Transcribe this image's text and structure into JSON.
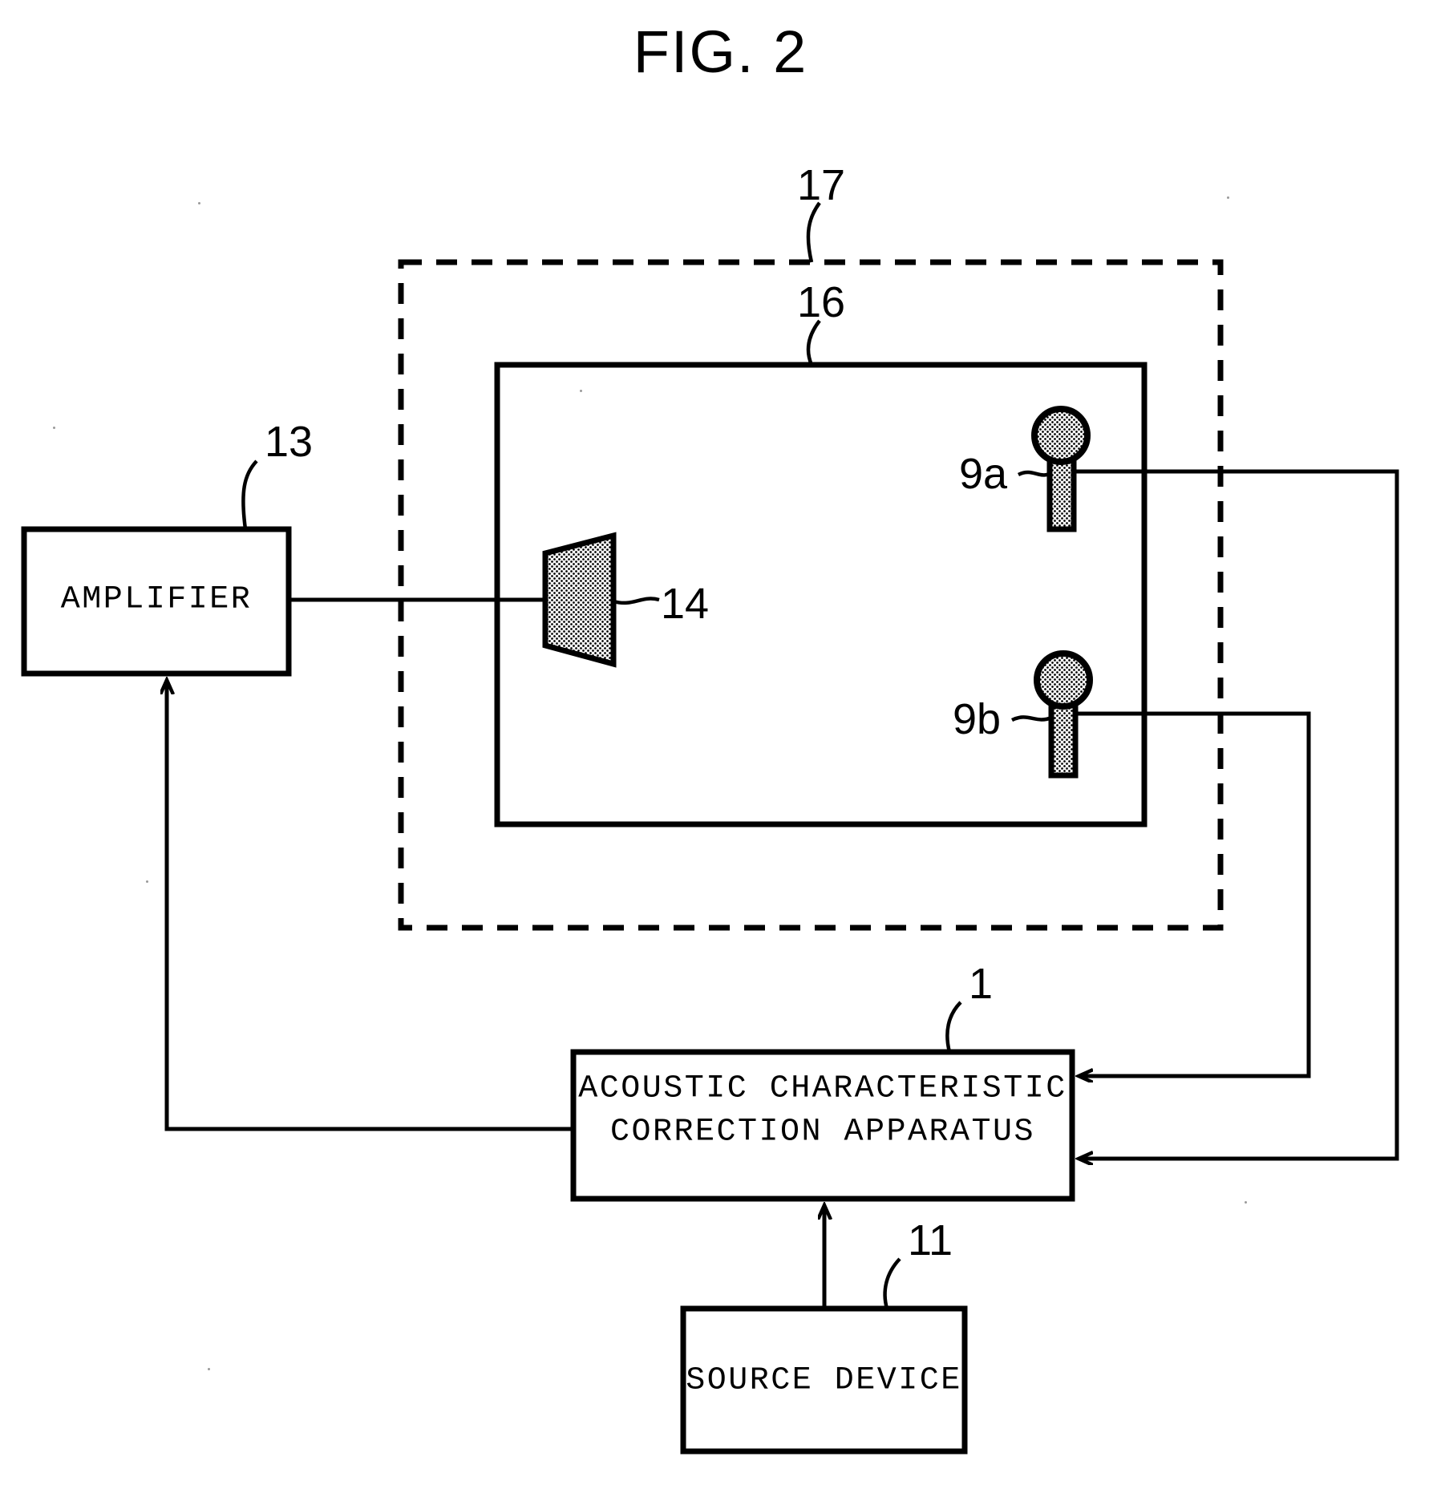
{
  "figure": {
    "title": "FIG. 2",
    "type": "patent-block-diagram"
  },
  "blocks": {
    "amplifier": {
      "label": "AMPLIFIER",
      "ref": "13"
    },
    "correction_apparatus": {
      "label_line1": "ACOUSTIC CHARACTERISTIC",
      "label_line2": "CORRECTION APPARATUS",
      "ref": "1"
    },
    "source_device": {
      "label": "SOURCE DEVICE",
      "ref": "11"
    }
  },
  "components": {
    "speaker": {
      "ref": "14",
      "shape": "trapezoid-halftone"
    },
    "microphone_a": {
      "ref": "9a",
      "shape": "mic-halftone"
    },
    "microphone_b": {
      "ref": "9b",
      "shape": "mic-halftone"
    },
    "inner_enclosure": {
      "ref": "16",
      "shape": "solid-rectangle"
    },
    "outer_enclosure": {
      "ref": "17",
      "shape": "dashed-rectangle"
    }
  },
  "colors": {
    "stroke": "#000000",
    "background": "#ffffff",
    "halftone": "#808080"
  }
}
